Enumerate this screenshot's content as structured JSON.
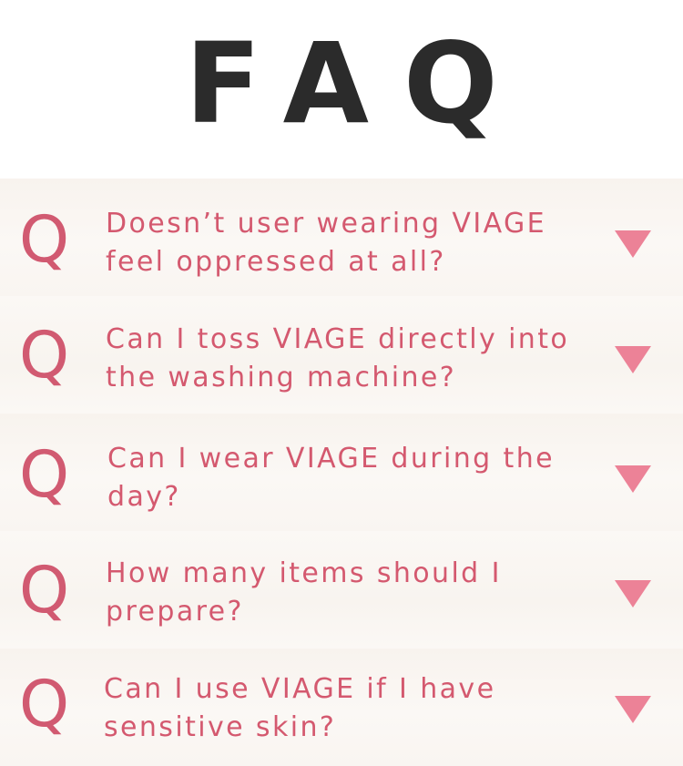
{
  "header": {
    "title": "FAQ"
  },
  "faq": {
    "q_label": "Q",
    "items": [
      {
        "question": "Doesn’t user wearing VIAGE feel oppressed at all?"
      },
      {
        "question": "Can I toss VIAGE directly into the washing machine?"
      },
      {
        "question": "Can I wear VIAGE during the day?"
      },
      {
        "question": "How many items should I prepare?"
      },
      {
        "question": "Can I use VIAGE if I have sensitive skin?"
      }
    ]
  },
  "icons": {
    "toggle": "triangle-down-icon"
  },
  "colors": {
    "title": "#2b2b2b",
    "accent": "#d4596f",
    "arrow": "#ec8297",
    "row_bg": "#f9f5f1"
  }
}
